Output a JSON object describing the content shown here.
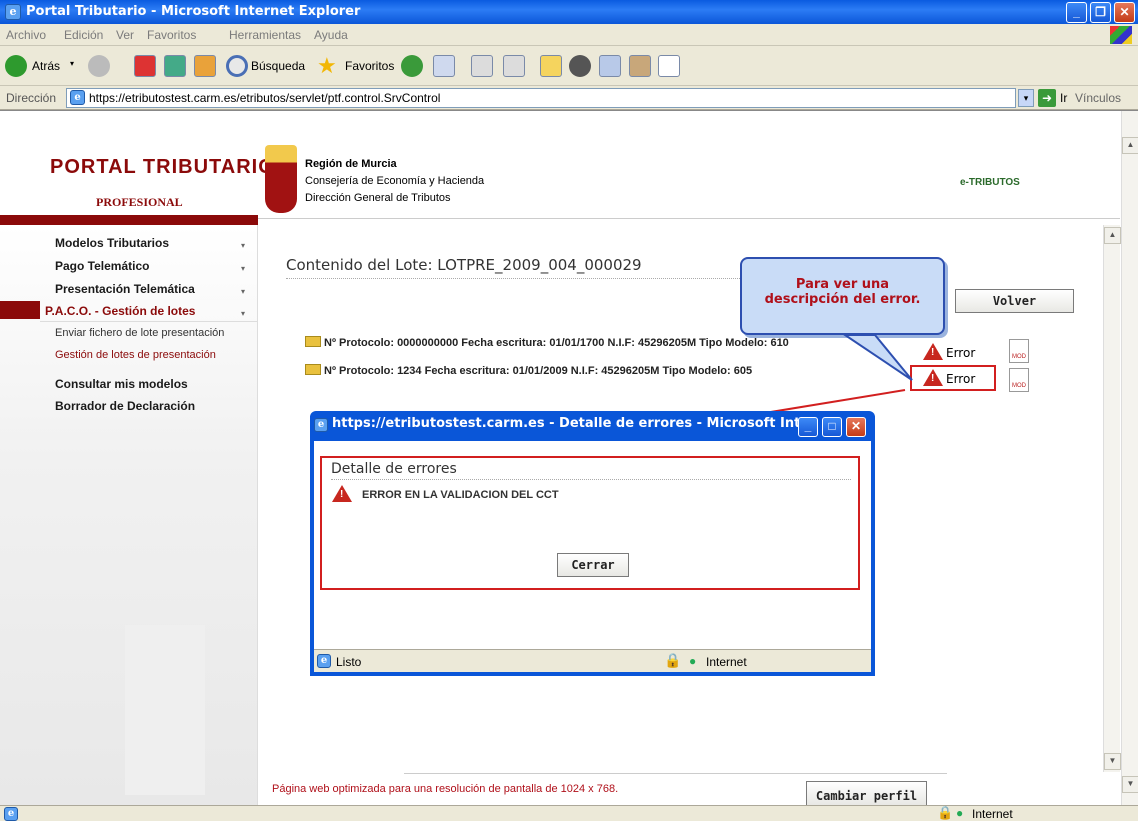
{
  "window": {
    "title": "Portal Tributario - Microsoft Internet Explorer"
  },
  "menu": [
    "Archivo",
    "Edición",
    "Ver",
    "Favoritos",
    "Herramientas",
    "Ayuda"
  ],
  "toolbar": {
    "back": "Atrás",
    "search": "Búsqueda",
    "favorites": "Favoritos"
  },
  "address": {
    "label": "Dirección",
    "url": "https://etributostest.carm.es/etributos/servlet/ptf.control.SrvControl",
    "go": "Ir",
    "links": "Vínculos"
  },
  "header": {
    "portal_title": "PORTAL TRIBUTARIO",
    "portal_sub": "PROFESIONAL",
    "region": "Región de Murcia",
    "consejeria": "Consejería de Economía y Hacienda",
    "direccion": "Dirección General de Tributos",
    "etributos": "e-TRIBUTOS"
  },
  "nav": {
    "items": [
      "Modelos Tributarios",
      "Pago Telemático",
      "Presentación Telemática",
      "P.A.C.O. - Gestión de lotes"
    ],
    "sub": [
      "Enviar fichero de lote presentación",
      "Gestión de lotes de presentación"
    ],
    "items2": [
      "Consultar mis modelos",
      "Borrador de Declaración"
    ]
  },
  "content": {
    "title": "Contenido del Lote: LOTPRE_2009_004_000029",
    "back_button": "Volver",
    "rows": [
      {
        "text": "Nº Protocolo: 0000000000  Fecha escritura: 01/01/1700  N.I.F: 45296205M  Tipo Modelo: 610",
        "status": "Error"
      },
      {
        "text": "Nº Protocolo: 1234  Fecha escritura: 01/01/2009  N.I.F: 45296205M  Tipo Modelo: 605",
        "status": "Error"
      }
    ],
    "footer_note": "Página web optimizada para una resolución de pantalla de 1024 x 768.",
    "change_profile": "Cambiar perfil"
  },
  "callout": {
    "line1": "Para ver una",
    "line2": "descripción del error."
  },
  "popup": {
    "title": "https://etributostest.carm.es - Detalle de errores - Microsoft Int...",
    "heading": "Detalle de errores",
    "error": "ERROR EN LA VALIDACION DEL CCT",
    "close_button": "Cerrar",
    "status": "Listo",
    "zone": "Internet"
  },
  "statusbar": {
    "zone": "Internet"
  },
  "colors": {
    "titlebar": "#0a5be0",
    "nav_active": "#8b0a0a",
    "callout_text": "#b0101a",
    "highlight": "#d21f1f"
  }
}
